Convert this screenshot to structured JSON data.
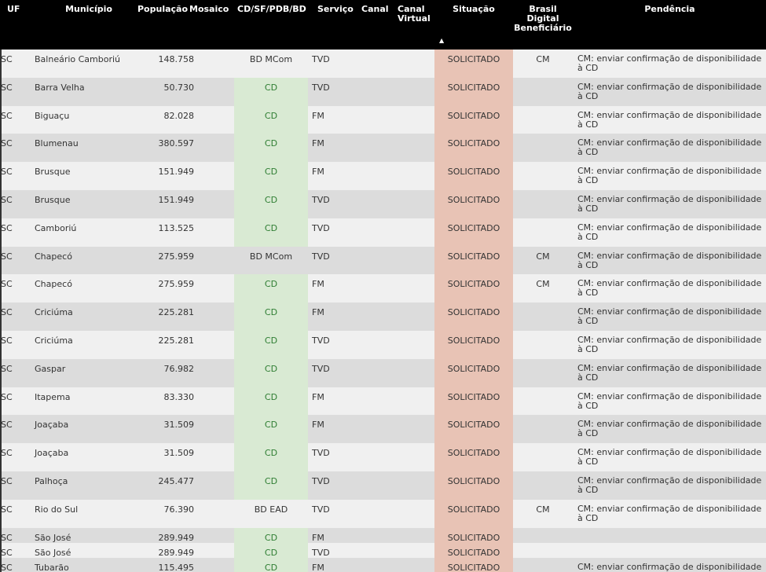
{
  "colors": {
    "header_bg": "#000000",
    "header_text": "#ffffff",
    "row_light": "#f0f0f0",
    "row_dark": "#dcdcdc",
    "cd_fill": "#d9ead3",
    "cd_text": "#2e7d32",
    "situacao_fill": "#e8c3b5",
    "text": "#333333"
  },
  "columns": {
    "uf": "UF",
    "municipio": "Município",
    "populacao": "População",
    "mosaico": "Mosaico",
    "cd": "CD/SF/PDB/BD",
    "servico": "Serviço",
    "canal": "Canal",
    "canal_virtual": "Canal\nVirtual",
    "situacao": "Situação",
    "brasil_digital": "Brasil\nDigital\nBeneficiário",
    "pendencia": "Pendência",
    "sort_icon": "▲"
  },
  "rows": [
    {
      "uf": "SC",
      "municipio": "Balneário Camboriú",
      "populacao": "148.758",
      "mosaico": "",
      "cd": "BD MCom",
      "servico": "TVD",
      "canal": "",
      "canal_virtual": "",
      "situacao": "SOLICITADO",
      "brasil_digital": "CM",
      "pendencia": "CM: enviar confirmação de disponibilidade à CD"
    },
    {
      "uf": "SC",
      "municipio": "Barra Velha",
      "populacao": "50.730",
      "mosaico": "",
      "cd": "CD",
      "servico": "TVD",
      "canal": "",
      "canal_virtual": "",
      "situacao": "SOLICITADO",
      "brasil_digital": "",
      "pendencia": "CM: enviar confirmação de disponibilidade à CD"
    },
    {
      "uf": "SC",
      "municipio": "Biguaçu",
      "populacao": "82.028",
      "mosaico": "",
      "cd": "CD",
      "servico": "FM",
      "canal": "",
      "canal_virtual": "",
      "situacao": "SOLICITADO",
      "brasil_digital": "",
      "pendencia": "CM: enviar confirmação de disponibilidade à CD"
    },
    {
      "uf": "SC",
      "municipio": "Blumenau",
      "populacao": "380.597",
      "mosaico": "",
      "cd": "CD",
      "servico": "FM",
      "canal": "",
      "canal_virtual": "",
      "situacao": "SOLICITADO",
      "brasil_digital": "",
      "pendencia": "CM: enviar confirmação de disponibilidade à CD"
    },
    {
      "uf": "SC",
      "municipio": "Brusque",
      "populacao": "151.949",
      "mosaico": "",
      "cd": "CD",
      "servico": "FM",
      "canal": "",
      "canal_virtual": "",
      "situacao": "SOLICITADO",
      "brasil_digital": "",
      "pendencia": "CM: enviar confirmação de disponibilidade à CD"
    },
    {
      "uf": "SC",
      "municipio": "Brusque",
      "populacao": "151.949",
      "mosaico": "",
      "cd": "CD",
      "servico": "TVD",
      "canal": "",
      "canal_virtual": "",
      "situacao": "SOLICITADO",
      "brasil_digital": "",
      "pendencia": "CM: enviar confirmação de disponibilidade à CD"
    },
    {
      "uf": "SC",
      "municipio": "Camboriú",
      "populacao": "113.525",
      "mosaico": "",
      "cd": "CD",
      "servico": "TVD",
      "canal": "",
      "canal_virtual": "",
      "situacao": "SOLICITADO",
      "brasil_digital": "",
      "pendencia": "CM: enviar confirmação de disponibilidade à CD"
    },
    {
      "uf": "SC",
      "municipio": "Chapecó",
      "populacao": "275.959",
      "mosaico": "",
      "cd": "BD MCom",
      "servico": "TVD",
      "canal": "",
      "canal_virtual": "",
      "situacao": "SOLICITADO",
      "brasil_digital": "CM",
      "pendencia": "CM: enviar confirmação de disponibilidade à CD"
    },
    {
      "uf": "SC",
      "municipio": "Chapecó",
      "populacao": "275.959",
      "mosaico": "",
      "cd": "CD",
      "servico": "FM",
      "canal": "",
      "canal_virtual": "",
      "situacao": "SOLICITADO",
      "brasil_digital": "CM",
      "pendencia": "CM: enviar confirmação de disponibilidade à CD"
    },
    {
      "uf": "SC",
      "municipio": "Criciúma",
      "populacao": "225.281",
      "mosaico": "",
      "cd": "CD",
      "servico": "FM",
      "canal": "",
      "canal_virtual": "",
      "situacao": "SOLICITADO",
      "brasil_digital": "",
      "pendencia": "CM: enviar confirmação de disponibilidade à CD"
    },
    {
      "uf": "SC",
      "municipio": "Criciúma",
      "populacao": "225.281",
      "mosaico": "",
      "cd": "CD",
      "servico": "TVD",
      "canal": "",
      "canal_virtual": "",
      "situacao": "SOLICITADO",
      "brasil_digital": "",
      "pendencia": "CM: enviar confirmação de disponibilidade à CD"
    },
    {
      "uf": "SC",
      "municipio": "Gaspar",
      "populacao": "76.982",
      "mosaico": "",
      "cd": "CD",
      "servico": "TVD",
      "canal": "",
      "canal_virtual": "",
      "situacao": "SOLICITADO",
      "brasil_digital": "",
      "pendencia": "CM: enviar confirmação de disponibilidade à CD"
    },
    {
      "uf": "SC",
      "municipio": "Itapema",
      "populacao": "83.330",
      "mosaico": "",
      "cd": "CD",
      "servico": "FM",
      "canal": "",
      "canal_virtual": "",
      "situacao": "SOLICITADO",
      "brasil_digital": "",
      "pendencia": "CM: enviar confirmação de disponibilidade à CD"
    },
    {
      "uf": "SC",
      "municipio": "Joaçaba",
      "populacao": "31.509",
      "mosaico": "",
      "cd": "CD",
      "servico": "FM",
      "canal": "",
      "canal_virtual": "",
      "situacao": "SOLICITADO",
      "brasil_digital": "",
      "pendencia": "CM: enviar confirmação de disponibilidade à CD"
    },
    {
      "uf": "SC",
      "municipio": "Joaçaba",
      "populacao": "31.509",
      "mosaico": "",
      "cd": "CD",
      "servico": "TVD",
      "canal": "",
      "canal_virtual": "",
      "situacao": "SOLICITADO",
      "brasil_digital": "",
      "pendencia": "CM: enviar confirmação de disponibilidade à CD"
    },
    {
      "uf": "SC",
      "municipio": "Palhoça",
      "populacao": "245.477",
      "mosaico": "",
      "cd": "CD",
      "servico": "TVD",
      "canal": "",
      "canal_virtual": "",
      "situacao": "SOLICITADO",
      "brasil_digital": "",
      "pendencia": "CM: enviar confirmação de disponibilidade à CD"
    },
    {
      "uf": "SC",
      "municipio": "Rio do Sul",
      "populacao": "76.390",
      "mosaico": "",
      "cd": "BD EAD",
      "servico": "TVD",
      "canal": "",
      "canal_virtual": "",
      "situacao": "SOLICITADO",
      "brasil_digital": "CM",
      "pendencia": "CM: enviar confirmação de disponibilidade à CD"
    },
    {
      "uf": "SC",
      "municipio": "São José",
      "populacao": "289.949",
      "mosaico": "",
      "cd": "CD",
      "servico": "FM",
      "canal": "",
      "canal_virtual": "",
      "situacao": "SOLICITADO",
      "brasil_digital": "",
      "pendencia": ""
    },
    {
      "uf": "SC",
      "municipio": "São José",
      "populacao": "289.949",
      "mosaico": "",
      "cd": "CD",
      "servico": "TVD",
      "canal": "",
      "canal_virtual": "",
      "situacao": "SOLICITADO",
      "brasil_digital": "",
      "pendencia": ""
    },
    {
      "uf": "SC",
      "municipio": "Tubarão",
      "populacao": "115.495",
      "mosaico": "",
      "cd": "CD",
      "servico": "FM",
      "canal": "",
      "canal_virtual": "",
      "situacao": "SOLICITADO",
      "brasil_digital": "",
      "pendencia": "CM: enviar confirmação de disponibilidade à CD"
    }
  ]
}
